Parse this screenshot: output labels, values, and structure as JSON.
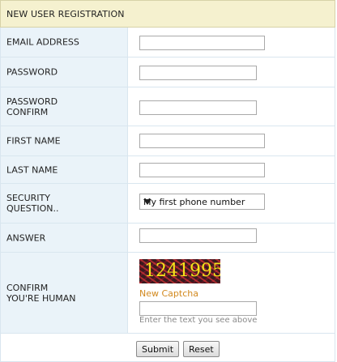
{
  "header": {
    "title": "NEW USER REGISTRATION"
  },
  "fields": {
    "email": {
      "label": "EMAIL ADDRESS",
      "value": ""
    },
    "password": {
      "label": "PASSWORD",
      "value": ""
    },
    "password_confirm": {
      "label": "PASSWORD CONFIRM",
      "value": ""
    },
    "first_name": {
      "label": "FIRST NAME",
      "value": ""
    },
    "last_name": {
      "label": "LAST NAME",
      "value": ""
    },
    "security_question": {
      "label": "SECURITY QUESTION..",
      "selected": "My first phone number"
    },
    "answer": {
      "label": "ANSWER",
      "value": ""
    },
    "captcha": {
      "label": "CONFIRM YOU'RE HUMAN",
      "code": "1241995",
      "new_link": "New Captcha",
      "hint": "Enter the text you see above",
      "value": ""
    }
  },
  "buttons": {
    "submit": "Submit",
    "reset": "Reset"
  },
  "colors": {
    "header_bg": "#f5f1cf",
    "label_bg": "#eaf3f9",
    "link": "#d2891e",
    "captcha_text": "#f4e21a"
  }
}
